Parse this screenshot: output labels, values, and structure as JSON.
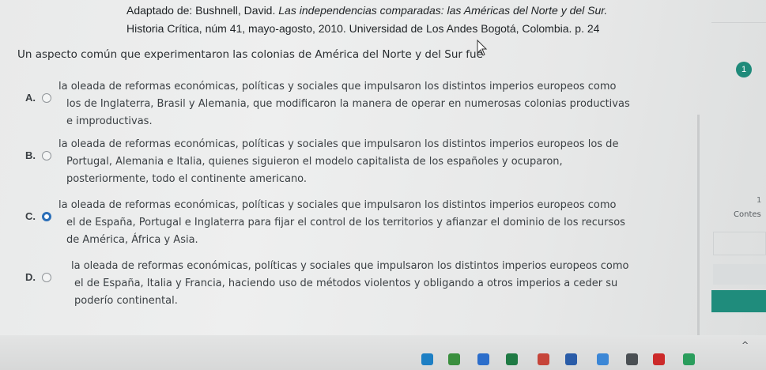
{
  "citation": {
    "line1": "Adaptado de: Bushnell, David. Las independencias comparadas: las Américas del Norte y del Sur.",
    "line2": "Historia Crítica, núm 41, mayo-agosto, 2010. Universidad de Los Andes Bogotá, Colombia. p. 24"
  },
  "question": {
    "number": "1",
    "text": "Un aspecto común que experimentaron las colonias de América del Norte y del Sur fue"
  },
  "options": [
    {
      "letter": "A.",
      "selected": false,
      "lines": [
        "la oleada de reformas económicas, políticas y sociales que impulsaron los distintos imperios europeos como",
        "los de Inglaterra, Brasil y Alemania, que modificaron la manera de operar en numerosas colonias productivas",
        "e improductivas."
      ]
    },
    {
      "letter": "B.",
      "selected": false,
      "lines": [
        "la oleada de reformas económicas, políticas y sociales que impulsaron los distintos imperios europeos los de",
        "Portugal, Alemania e Italia, quienes siguieron el modelo capitalista de los españoles y ocuparon,",
        "posteriormente, todo el continente americano."
      ]
    },
    {
      "letter": "C.",
      "selected": true,
      "lines": [
        "la oleada de reformas económicas, políticas y sociales que impulsaron los distintos imperios europeos como",
        "el de España, Portugal e Inglaterra para fijar el control de los territorios y afianzar el dominio de los recursos",
        "de América, África y Asia."
      ]
    },
    {
      "letter": "D.",
      "selected": false,
      "lines": [
        "la oleada de reformas económicas, políticas y sociales que impulsaron los distintos imperios europeos como",
        "el de España, Italia y Francia, haciendo uso de métodos violentos y obligando a otros imperios a ceder su",
        "poderío continental."
      ]
    }
  ],
  "side_panel": {
    "number": "1",
    "label": "Contes"
  },
  "taskbar": {
    "icons": [
      "edge-icon",
      "chrome-icon",
      "files-icon",
      "excel-icon",
      "powerpoint-icon",
      "word-icon",
      "search-icon",
      "n-icon",
      "youtube-icon",
      "drive-icon"
    ],
    "expand_glyph": "^"
  },
  "colors": {
    "accent": "#2b6fb8",
    "badge": "#1f8a7a",
    "teal_button": "#1f8c7c"
  }
}
